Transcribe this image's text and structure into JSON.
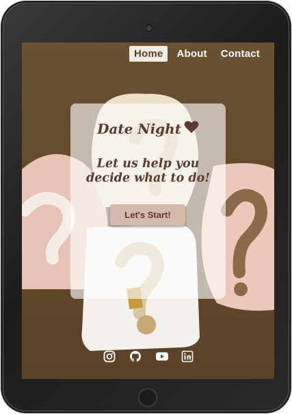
{
  "nav": {
    "items": [
      {
        "label": "Home",
        "active": true
      },
      {
        "label": "About",
        "active": false
      },
      {
        "label": "Contact",
        "active": false
      }
    ]
  },
  "card": {
    "title": "Date Night",
    "title_icon": "heart-icon",
    "tagline": "Let us help you decide what to do!",
    "button_label": "Let's Start!"
  },
  "footer": {
    "social_icons": [
      "instagram-icon",
      "github-icon",
      "youtube-icon",
      "linkedin-icon"
    ]
  },
  "colors": {
    "text_brown": "#5b3a30",
    "button_bg": "#d6b9ad",
    "nav_active_bg": "#f4ebe4",
    "background": "#6b5436"
  }
}
